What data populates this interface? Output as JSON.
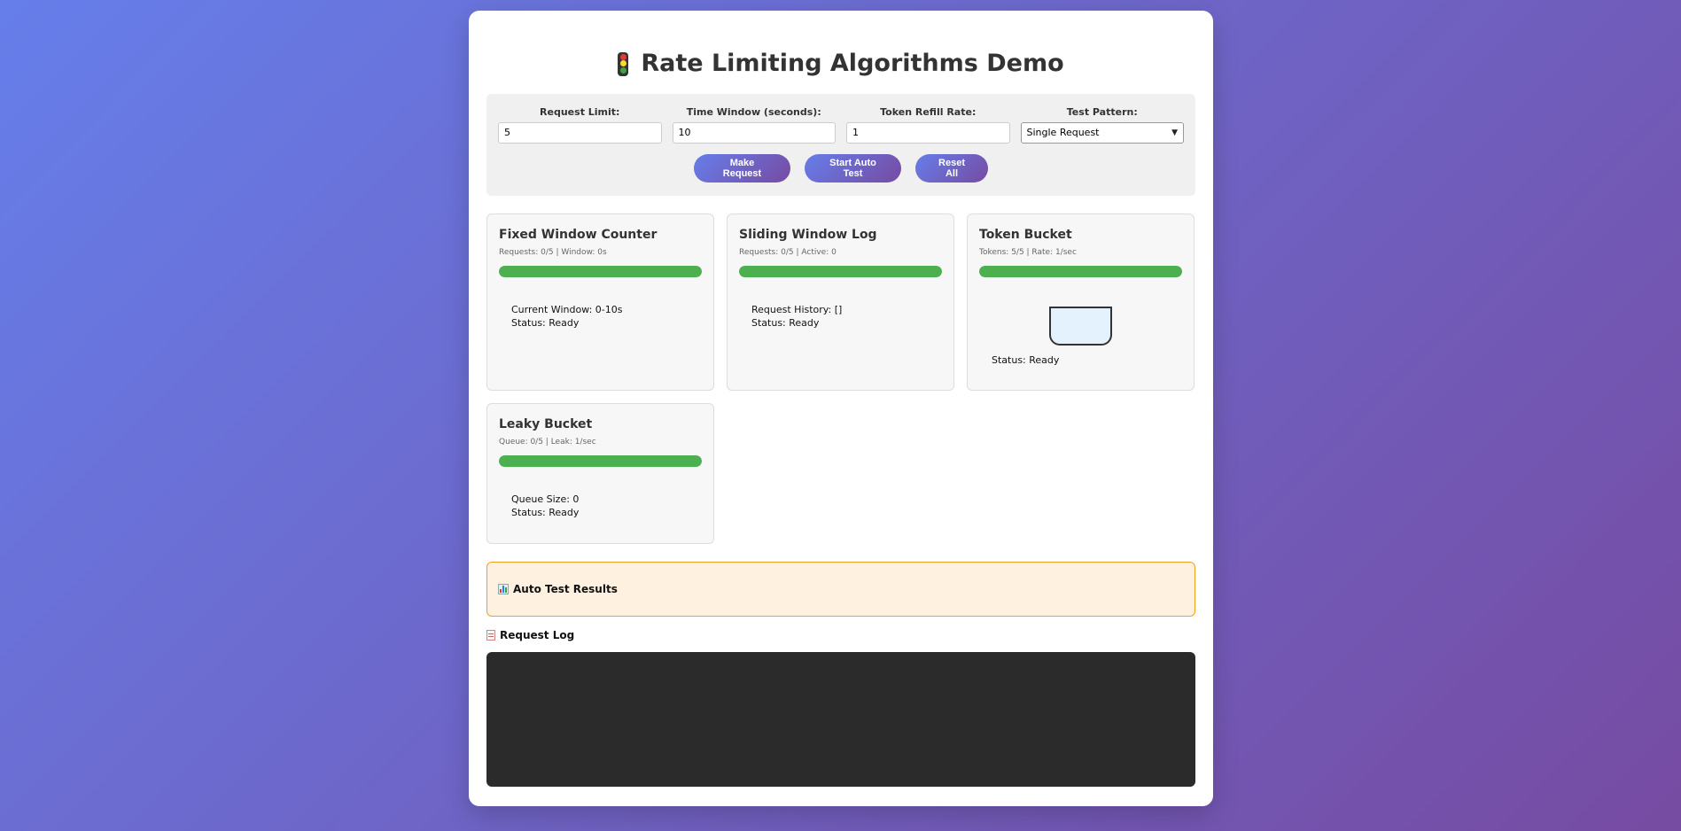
{
  "header": {
    "title": "Rate Limiting Algorithms Demo",
    "icon": "traffic-light-icon"
  },
  "controls": {
    "request_limit": {
      "label": "Request Limit:",
      "value": "5"
    },
    "time_window": {
      "label": "Time Window (seconds):",
      "value": "10"
    },
    "refill_rate": {
      "label": "Token Refill Rate:",
      "value": "1"
    },
    "test_pattern": {
      "label": "Test Pattern:",
      "value": "Single Request"
    },
    "buttons": {
      "make_request": "Make Request",
      "start_auto_test": "Start Auto Test",
      "reset_all": "Reset All"
    }
  },
  "algorithms": [
    {
      "title": "Fixed Window Counter",
      "stats": "Requests: 0/5 | Window: 0s",
      "progress": 1.0,
      "details": [
        "Current Window: 0-10s",
        "Status: Ready"
      ]
    },
    {
      "title": "Sliding Window Log",
      "stats": "Requests: 0/5 | Active: 0",
      "progress": 1.0,
      "details": [
        "Request History: []",
        "Status: Ready"
      ]
    },
    {
      "title": "Token Bucket",
      "stats": "Tokens: 5/5 | Rate: 1/sec",
      "progress": 1.0,
      "details": [
        "Status: Ready"
      ]
    },
    {
      "title": "Leaky Bucket",
      "stats": "Queue: 0/5 | Leak: 1/sec",
      "progress": 1.0,
      "details": [
        "Queue Size: 0",
        "Status: Ready"
      ]
    }
  ],
  "results": {
    "title": "Auto Test Results",
    "icon": "bar-chart-icon"
  },
  "log": {
    "title": "Request Log",
    "icon": "memo-icon",
    "entries": []
  },
  "colors": {
    "gradient_start": "#667eea",
    "gradient_end": "#764ba2",
    "progress": "#4caf50",
    "results_border": "#f0a020",
    "results_bg": "#fff1e0",
    "log_bg": "#2b2b2b"
  }
}
